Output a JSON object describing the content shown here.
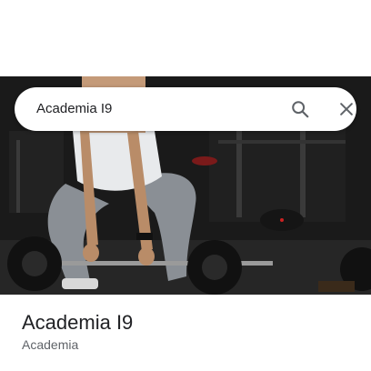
{
  "search": {
    "value": "Academia I9"
  },
  "place": {
    "title": "Academia I9",
    "category": "Academia"
  },
  "icons": {
    "search": "search-icon",
    "close": "close-icon"
  },
  "colors": {
    "text_primary": "#202124",
    "text_secondary": "#5f6368",
    "icon": "#5f6368"
  }
}
